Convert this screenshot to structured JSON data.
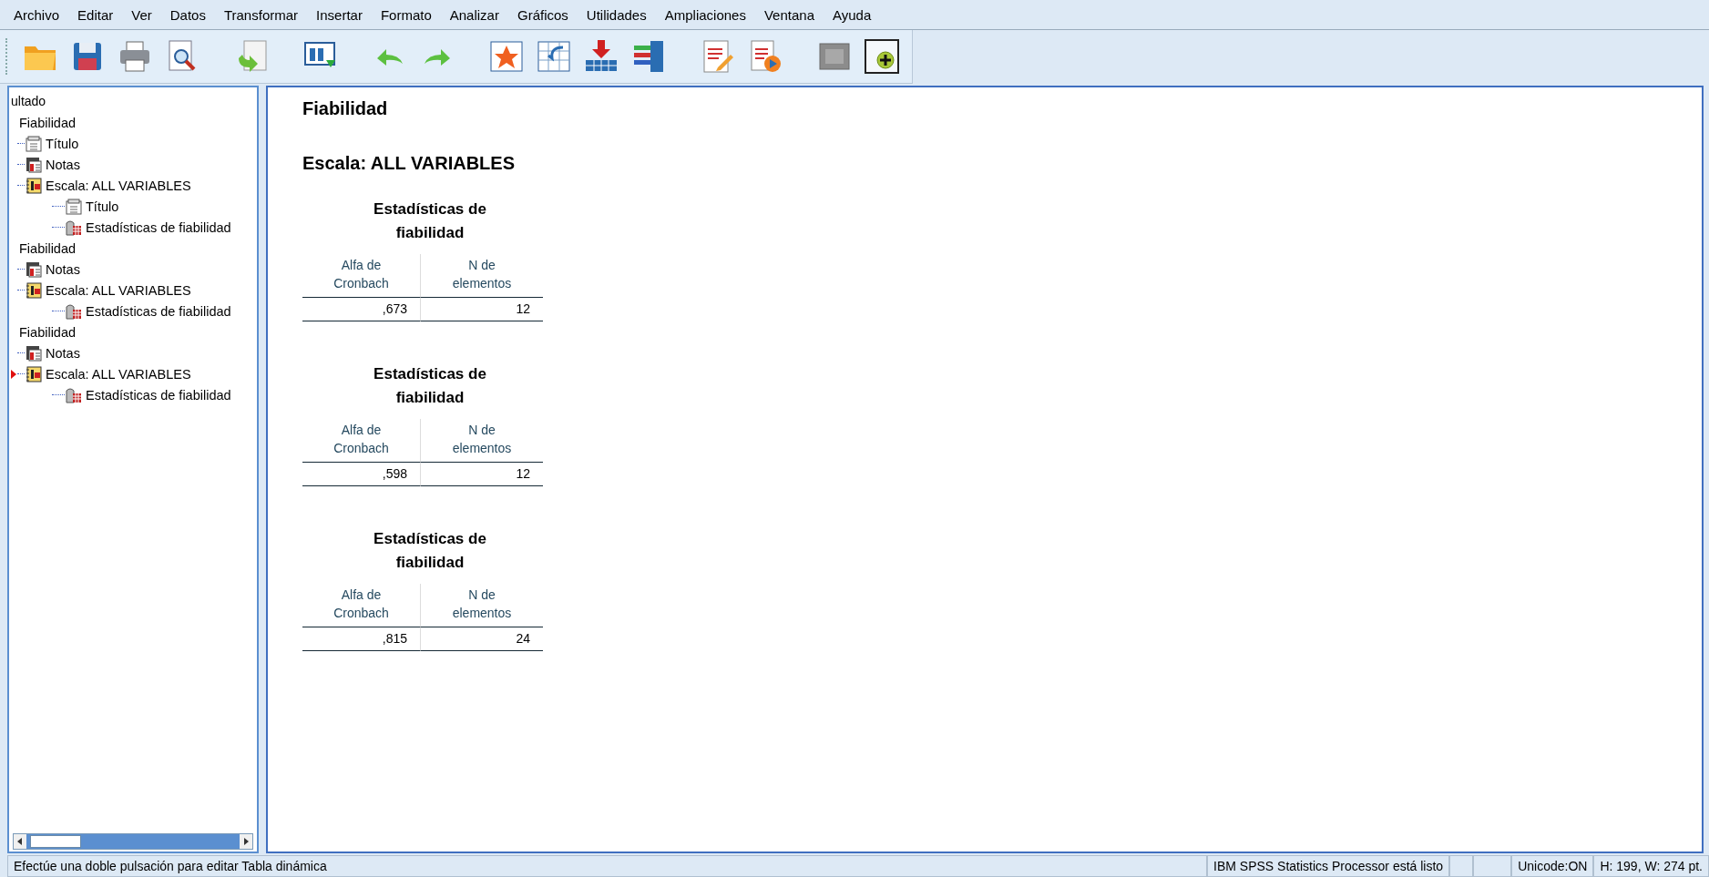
{
  "menu": [
    "Archivo",
    "Editar",
    "Ver",
    "Datos",
    "Transformar",
    "Insertar",
    "Formato",
    "Analizar",
    "Gráficos",
    "Utilidades",
    "Ampliaciones",
    "Ventana",
    "Ayuda"
  ],
  "outline": {
    "label": "ultado",
    "children": [
      {
        "label": "Fiabilidad",
        "kind": "heading",
        "selected": false,
        "children": [
          {
            "label": "Título",
            "kind": "title",
            "selected": false
          },
          {
            "label": "Notas",
            "kind": "notes",
            "selected": false
          },
          {
            "label": "Escala: ALL VARIABLES",
            "kind": "scale",
            "selected": false,
            "children": [
              {
                "label": "Título",
                "kind": "title",
                "selected": false
              },
              {
                "label": "Estadísticas de fiabilidad",
                "kind": "stats",
                "selected": false
              }
            ]
          }
        ]
      },
      {
        "label": "Fiabilidad",
        "kind": "heading",
        "selected": false,
        "children": [
          {
            "label": "Notas",
            "kind": "notes",
            "selected": false
          },
          {
            "label": "Escala: ALL VARIABLES",
            "kind": "scale",
            "selected": false,
            "children": [
              {
                "label": "Estadísticas de fiabilidad",
                "kind": "stats",
                "selected": false
              }
            ]
          }
        ]
      },
      {
        "label": "Fiabilidad",
        "kind": "heading",
        "selected": false,
        "children": [
          {
            "label": "Notas",
            "kind": "notes",
            "selected": false
          },
          {
            "label": "Escala: ALL VARIABLES",
            "kind": "scale",
            "selected": true,
            "children": [
              {
                "label": "Estadísticas de fiabilidad",
                "kind": "stats",
                "selected": false
              }
            ]
          }
        ]
      }
    ]
  },
  "output": {
    "heading": "Fiabilidad",
    "subheading": "Escala: ALL VARIABLES",
    "tables": [
      {
        "title": "Estadísticas de fiabilidad",
        "columns": [
          "Alfa de Cronbach",
          "N de elementos"
        ],
        "row": [
          ",673",
          "12"
        ]
      },
      {
        "title": "Estadísticas de fiabilidad",
        "columns": [
          "Alfa de Cronbach",
          "N de elementos"
        ],
        "row": [
          ",598",
          "12"
        ]
      },
      {
        "title": "Estadísticas de fiabilidad",
        "columns": [
          "Alfa de Cronbach",
          "N de elementos"
        ],
        "row": [
          ",815",
          "24"
        ]
      }
    ]
  },
  "status_bar": {
    "message": "Efectúe una doble pulsación para editar Tabla dinámica",
    "processor": "IBM SPSS Statistics Processor está listo",
    "unicode": "Unicode:ON",
    "size": "H: 199, W: 274 pt."
  }
}
